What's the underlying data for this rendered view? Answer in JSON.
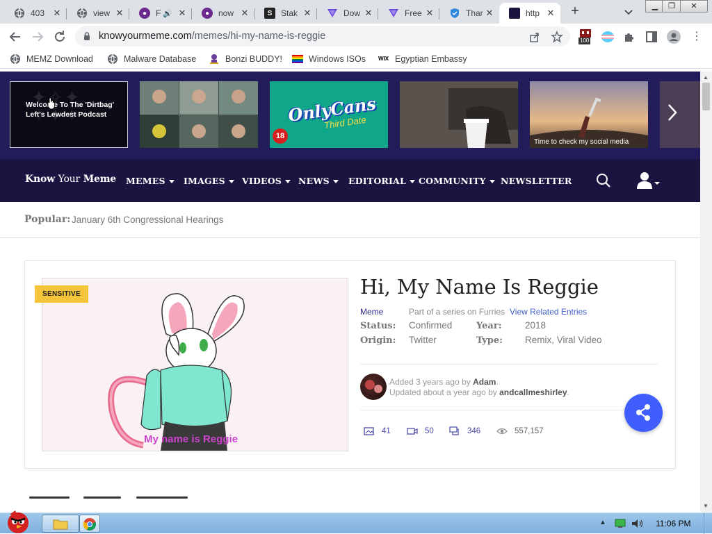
{
  "browser": {
    "tabs": [
      {
        "title": "403",
        "favicon": "globe-icon",
        "color": "#5f6368"
      },
      {
        "title": "view",
        "favicon": "globe-icon",
        "color": "#5f6368"
      },
      {
        "title": "F",
        "favicon": "paint-icon",
        "color": "#6b2a8c"
      },
      {
        "title": "now",
        "favicon": "paint-icon",
        "color": "#6b2a8c"
      },
      {
        "title": "Stak",
        "favicon": "s-icon",
        "color": "#222222"
      },
      {
        "title": "Dow",
        "favicon": "vee-icon",
        "color": "#6c4be0"
      },
      {
        "title": "Free",
        "favicon": "vee-icon",
        "color": "#6c4be0"
      },
      {
        "title": "Thar",
        "favicon": "shield-icon",
        "color": "#2e88e0"
      },
      {
        "title": "http",
        "favicon": "kym-icon",
        "color": "#1c1440",
        "active": true
      }
    ],
    "url_host": "knowyourmeme.com",
    "url_path": "/memes/hi-my-name-is-reggie",
    "ext_badge": "100",
    "bookmarks": [
      {
        "label": "MEMZ Download",
        "icon": "globe-icon"
      },
      {
        "label": "Malware Database",
        "icon": "globe-icon"
      },
      {
        "label": "Bonzi BUDDY!",
        "icon": "bonzi-icon"
      },
      {
        "label": "Windows ISOs",
        "icon": "rainbow-flag-icon"
      },
      {
        "label": "Egyptian Embassy",
        "icon": "wix-icon"
      }
    ],
    "wix_text": "WIX"
  },
  "site": {
    "logo_know": "Know",
    "logo_your": "Your",
    "logo_meme": "Meme",
    "promo_1_text": "Welcome To The 'Dirtbag' Left's Lewdest Podcast",
    "promo_3_text": "OnlyCans",
    "promo_3_sub": "Third Date",
    "promo_3_badge": "18",
    "promo_5_text": "Time to check my social media",
    "nav": [
      {
        "label": "MEMES",
        "caret": true
      },
      {
        "label": "IMAGES",
        "caret": true
      },
      {
        "label": "VIDEOS",
        "caret": true
      },
      {
        "label": "NEWS",
        "caret": true
      },
      {
        "label": "EDITORIAL",
        "caret": true
      },
      {
        "label": "COMMUNITY",
        "caret": true
      },
      {
        "label": "NEWSLETTER",
        "caret": false
      }
    ],
    "popular_label": "Popular:",
    "popular_link": "January 6th Congressional Hearings"
  },
  "entry": {
    "sensitive": "SENSITIVE",
    "title": "Hi, My Name Is Reggie",
    "category": "Meme",
    "series_text": "Part of a series on Furries",
    "related_link": "View Related Entries",
    "status_label": "Status:",
    "status_value": "Confirmed",
    "year_label": "Year:",
    "year_value": "2018",
    "origin_label": "Origin:",
    "origin_value": "Twitter",
    "type_label": "Type:",
    "type_value": "Remix, Viral Video",
    "added_prefix": "Added 3 years ago by",
    "added_by": "Adam",
    "updated_prefix": "Updated about a year ago by",
    "updated_by": "andcallmeshirley",
    "image_caption": "My name is Reggie",
    "stats": {
      "images": "41",
      "videos": "50",
      "comments": "346",
      "views": "557,157"
    }
  },
  "taskbar": {
    "clock": "11:06 PM"
  }
}
